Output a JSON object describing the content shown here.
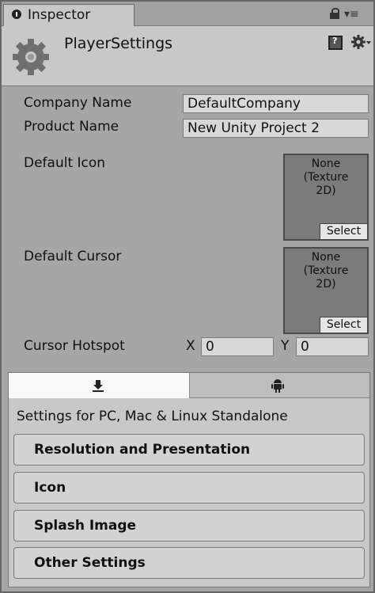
{
  "window": {
    "tab_title": "Inspector",
    "menu_symbol": "▾≡"
  },
  "header": {
    "title": "PlayerSettings"
  },
  "properties": {
    "company_name": {
      "label": "Company Name",
      "value": "DefaultCompany"
    },
    "product_name": {
      "label": "Product Name",
      "value": "New Unity Project 2"
    },
    "default_icon": {
      "label": "Default Icon",
      "value": "None\n(Texture\n2D)",
      "button": "Select"
    },
    "default_cursor": {
      "label": "Default Cursor",
      "value": "None\n(Texture\n2D)",
      "button": "Select"
    },
    "cursor_hotspot": {
      "label": "Cursor Hotspot",
      "x_label": "X",
      "x_value": "0",
      "y_label": "Y",
      "y_value": "0"
    }
  },
  "platform": {
    "tabs": [
      {
        "name": "standalone",
        "icon": "download-icon",
        "selected": true
      },
      {
        "name": "android",
        "icon": "android-icon",
        "selected": false
      }
    ],
    "title": "Settings for PC, Mac & Linux Standalone",
    "sections": [
      {
        "label": "Resolution and Presentation"
      },
      {
        "label": "Icon"
      },
      {
        "label": "Splash Image"
      },
      {
        "label": "Other Settings"
      }
    ]
  }
}
